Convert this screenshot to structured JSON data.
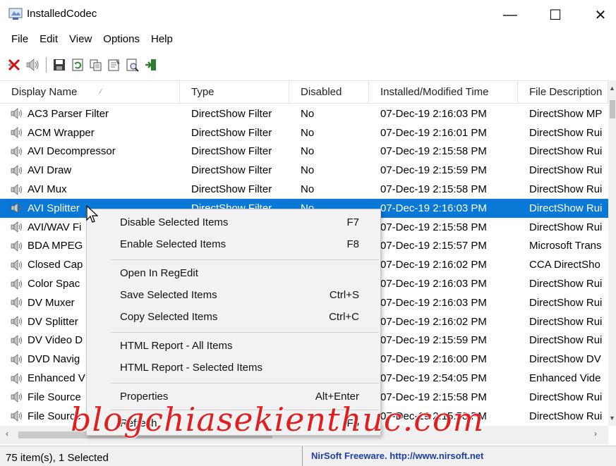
{
  "window": {
    "title": "InstalledCodec",
    "minimize": "—",
    "maximize": "☐",
    "close": "✕"
  },
  "menu": {
    "items": [
      "File",
      "Edit",
      "View",
      "Options",
      "Help"
    ]
  },
  "toolbar": {
    "buttons": [
      "disable-icon",
      "enable-icon",
      "save-icon",
      "refresh-icon",
      "copy-icon",
      "properties-icon",
      "html-report-icon",
      "exit-icon"
    ]
  },
  "list": {
    "columns": [
      "Display Name",
      "Type",
      "Disabled",
      "Installed/Modified Time",
      "File Description"
    ],
    "sort_indicator": "⁄",
    "rows": [
      {
        "name": "AC3 Parser Filter",
        "type": "DirectShow Filter",
        "disabled": "No",
        "time": "07-Dec-19 2:16:03 PM",
        "desc": "DirectShow MP"
      },
      {
        "name": "ACM Wrapper",
        "type": "DirectShow Filter",
        "disabled": "No",
        "time": "07-Dec-19 2:16:01 PM",
        "desc": "DirectShow Rui"
      },
      {
        "name": "AVI Decompressor",
        "type": "DirectShow Filter",
        "disabled": "No",
        "time": "07-Dec-19 2:15:58 PM",
        "desc": "DirectShow Rui"
      },
      {
        "name": "AVI Draw",
        "type": "DirectShow Filter",
        "disabled": "No",
        "time": "07-Dec-19 2:15:59 PM",
        "desc": "DirectShow Rui"
      },
      {
        "name": "AVI Mux",
        "type": "DirectShow Filter",
        "disabled": "No",
        "time": "07-Dec-19 2:15:58 PM",
        "desc": "DirectShow Rui"
      },
      {
        "name": "AVI Splitter",
        "type": "DirectShow Filter",
        "disabled": "No",
        "time": "07-Dec-19 2:16:03 PM",
        "desc": "DirectShow Rui",
        "selected": true
      },
      {
        "name": "AVI/WAV Fi",
        "type": "",
        "disabled": "",
        "time": "07-Dec-19 2:15:58 PM",
        "desc": "DirectShow Rui"
      },
      {
        "name": "BDA MPEG",
        "type": "",
        "disabled": "",
        "time": "07-Dec-19 2:15:57 PM",
        "desc": "Microsoft Trans"
      },
      {
        "name": "Closed Cap",
        "type": "",
        "disabled": "",
        "time": "07-Dec-19 2:16:02 PM",
        "desc": "CCA DirectSho"
      },
      {
        "name": "Color Spac",
        "type": "",
        "disabled": "",
        "time": "07-Dec-19 2:16:03 PM",
        "desc": "DirectShow Rui"
      },
      {
        "name": "DV Muxer",
        "type": "",
        "disabled": "",
        "time": "07-Dec-19 2:16:03 PM",
        "desc": "DirectShow Rui"
      },
      {
        "name": "DV Splitter",
        "type": "",
        "disabled": "",
        "time": "07-Dec-19 2:16:02 PM",
        "desc": "DirectShow Rui"
      },
      {
        "name": "DV Video D",
        "type": "",
        "disabled": "",
        "time": "07-Dec-19 2:15:59 PM",
        "desc": "DirectShow Rui"
      },
      {
        "name": "DVD Navig",
        "type": "",
        "disabled": "",
        "time": "07-Dec-19 2:16:00 PM",
        "desc": "DirectShow DV"
      },
      {
        "name": "Enhanced V",
        "type": "",
        "disabled": "",
        "time": "07-Dec-19 2:54:05 PM",
        "desc": "Enhanced Vide"
      },
      {
        "name": "File Source",
        "type": "",
        "disabled": "",
        "time": "07-Dec-19 2:15:58 PM",
        "desc": "DirectShow Rui"
      },
      {
        "name": "File Source",
        "type": "",
        "disabled": "",
        "time": "07-Dec-19 2:15:58 PM",
        "desc": "DirectShow Rui"
      }
    ]
  },
  "context_menu": {
    "items": [
      {
        "label": "Disable Selected Items",
        "shortcut": "F7"
      },
      {
        "label": "Enable Selected Items",
        "shortcut": "F8"
      },
      {
        "label": "Open In RegEdit",
        "shortcut": ""
      },
      {
        "label": "Save Selected Items",
        "shortcut": "Ctrl+S"
      },
      {
        "label": "Copy Selected Items",
        "shortcut": "Ctrl+C"
      },
      {
        "label": "HTML Report - All Items",
        "shortcut": ""
      },
      {
        "label": "HTML Report - Selected Items",
        "shortcut": ""
      },
      {
        "label": "Properties",
        "shortcut": "Alt+Enter"
      },
      {
        "label": "Refresh",
        "shortcut": "F5"
      }
    ]
  },
  "status": {
    "count": "75 item(s), 1 Selected",
    "credit": "NirSoft Freeware.  http://www.nirsoft.net"
  },
  "watermark": "blogchiasekienthuc.com",
  "colors": {
    "selection": "#0a78d7",
    "watermark": "#e41e1e",
    "credit_link": "#1c3ea6"
  }
}
